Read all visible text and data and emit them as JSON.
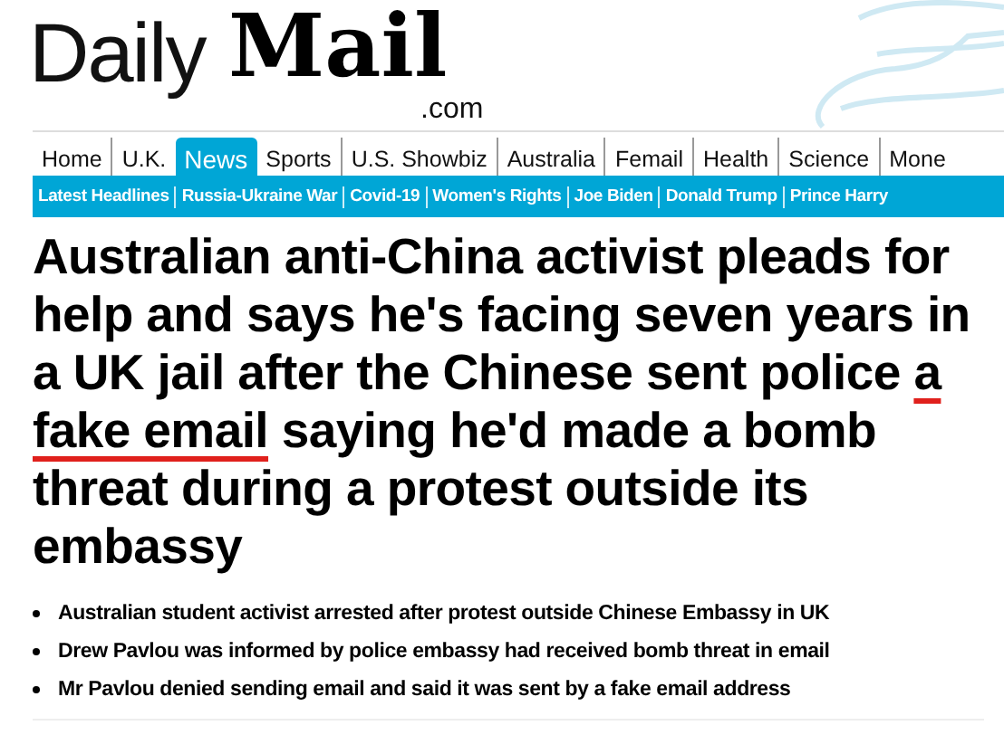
{
  "logo": {
    "word_1": "Daily",
    "word_2": "Mail",
    "domain": ".com"
  },
  "nav": [
    {
      "label": "Home",
      "selected": false
    },
    {
      "label": "U.K.",
      "selected": false
    },
    {
      "label": "News",
      "selected": true
    },
    {
      "label": "Sports",
      "selected": false
    },
    {
      "label": "U.S. Showbiz",
      "selected": false
    },
    {
      "label": "Australia",
      "selected": false
    },
    {
      "label": "Femail",
      "selected": false
    },
    {
      "label": "Health",
      "selected": false
    },
    {
      "label": "Science",
      "selected": false
    },
    {
      "label": "Mone",
      "selected": false
    }
  ],
  "subnav": [
    "Latest Headlines",
    "Russia-Ukraine War",
    "Covid-19",
    "Women's Rights",
    "Joe Biden",
    "Donald Trump",
    "Prince Harry"
  ],
  "headline": [
    {
      "text": "Australian anti-China activist pleads for help and says he's facing seven years in a UK jail after the Chinese sent police ",
      "underlined": false
    },
    {
      "text": "a fake email",
      "underlined": true
    },
    {
      "text": " saying he'd made a bomb threat during a protest outside its embassy",
      "underlined": false
    }
  ],
  "bullets": [
    "Australian student activist arrested after protest outside Chinese Embassy in UK",
    "Drew Pavlou was informed by police embassy had received bomb threat in email",
    "Mr Pavlou denied sending email and said it was sent by a fake email address"
  ]
}
